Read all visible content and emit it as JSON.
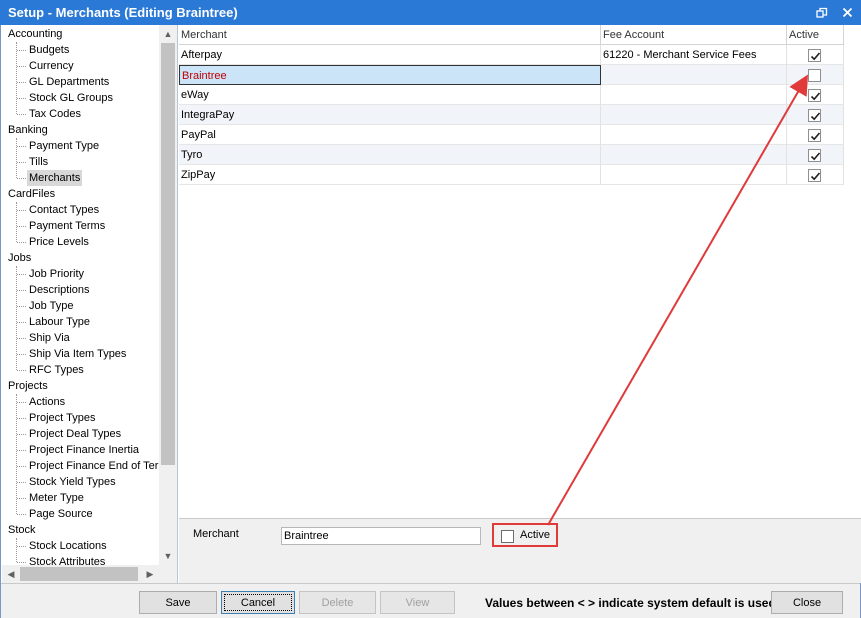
{
  "window": {
    "title": "Setup - Merchants (Editing Braintree)"
  },
  "tree": {
    "categories": [
      {
        "label": "Accounting",
        "children": [
          "Budgets",
          "Currency",
          "GL Departments",
          "Stock GL Groups",
          "Tax Codes"
        ]
      },
      {
        "label": "Banking",
        "children": [
          "Payment Type",
          "Tills",
          "Merchants"
        ]
      },
      {
        "label": "CardFiles",
        "children": [
          "Contact Types",
          "Payment Terms",
          "Price Levels"
        ]
      },
      {
        "label": "Jobs",
        "children": [
          "Job Priority",
          "Descriptions",
          "Job Type",
          "Labour Type",
          "Ship Via",
          "Ship Via Item Types",
          "RFC Types"
        ]
      },
      {
        "label": "Projects",
        "children": [
          "Actions",
          "Project Types",
          "Project Deal Types",
          "Project Finance Inertia",
          "Project Finance End of Term",
          "Stock Yield Types",
          "Meter Type",
          "Page Source"
        ]
      },
      {
        "label": "Stock",
        "children": [
          "Stock Locations",
          "Stock Attributes"
        ]
      }
    ],
    "selected": "Merchants"
  },
  "grid": {
    "columns": [
      "Merchant",
      "Fee Account",
      "Active"
    ],
    "rows": [
      {
        "merchant": "Afterpay",
        "fee_account": "61220 - Merchant Service Fees",
        "active": true
      },
      {
        "merchant": "Braintree",
        "fee_account": "",
        "active": false,
        "editing": true
      },
      {
        "merchant": "eWay",
        "fee_account": "",
        "active": true
      },
      {
        "merchant": "IntegraPay",
        "fee_account": "",
        "active": true
      },
      {
        "merchant": "PayPal",
        "fee_account": "",
        "active": true
      },
      {
        "merchant": "Tyro",
        "fee_account": "",
        "active": true
      },
      {
        "merchant": "ZipPay",
        "fee_account": "",
        "active": true
      }
    ]
  },
  "editor": {
    "merchant_label": "Merchant",
    "merchant_value": "Braintree",
    "active_label": "Active",
    "active_checked": false
  },
  "buttons": {
    "save": "Save",
    "cancel": "Cancel",
    "delete": "Delete",
    "view": "View",
    "close": "Close"
  },
  "note": "Values between < > indicate system default is used",
  "colors": {
    "titlebar": "#2b79d7",
    "highlight_red": "#e03a3a",
    "editing_cell": "#cce4f7",
    "editing_text": "#c00000"
  }
}
